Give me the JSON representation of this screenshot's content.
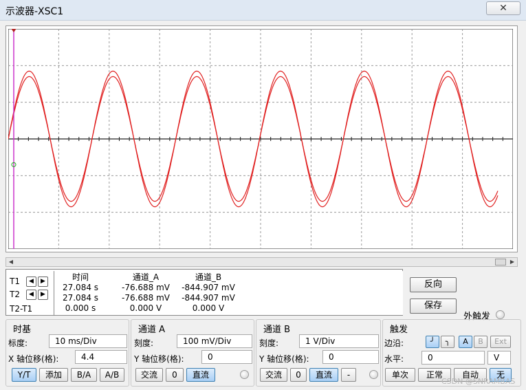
{
  "window": {
    "title": "示波器-XSC1",
    "close_icon": "close-icon"
  },
  "chart_data": {
    "type": "line",
    "title": "",
    "xlabel": "",
    "ylabel": "",
    "grid": true,
    "grid_divisions": {
      "x": 10,
      "y": 6
    },
    "x_per_div_ms": 10,
    "x_range_ms": [
      0,
      100
    ],
    "y_range_div": [
      -3,
      3
    ],
    "signal_period_ms": 16.6,
    "series": [
      {
        "color": "#e02020",
        "amplitude_div": 1.85,
        "phase": 0.0
      },
      {
        "color": "#e02020",
        "amplitude_div": 1.7,
        "phase": 0.0
      }
    ],
    "trigger_marker_color": "#18a818",
    "cursor_color": "#cc33cc"
  },
  "cursors": {
    "headers": [
      "时间",
      "通道_A",
      "通道_B"
    ],
    "rows": [
      {
        "label": "T1",
        "values": [
          "27.084 s",
          "-76.688 mV",
          "-844.907 mV"
        ]
      },
      {
        "label": "T2",
        "values": [
          "27.084 s",
          "-76.688 mV",
          "-844.907 mV"
        ]
      },
      {
        "label": "T2-T1",
        "values": [
          "0.000 s",
          "0.000 V",
          "0.000 V"
        ]
      }
    ]
  },
  "side_buttons": {
    "reverse": "反向",
    "save": "保存",
    "ext_trigger": "外触发"
  },
  "timebase": {
    "title": "时基",
    "scale_label": "标度:",
    "scale_value": "10 ms/Div",
    "xpos_label": "X 轴位移(格):",
    "xpos_value": "4.4",
    "modes": [
      "Y/T",
      "添加",
      "B/A",
      "A/B"
    ],
    "active_mode": "Y/T"
  },
  "channel_a": {
    "title": "通道 A",
    "scale_label": "刻度:",
    "scale_value": "100 mV/Div",
    "ypos_label": "Y 轴位移(格):",
    "ypos_value": "0",
    "coupling": [
      "交流",
      "0",
      "直流"
    ],
    "active": "直流"
  },
  "channel_b": {
    "title": "通道 B",
    "scale_label": "刻度:",
    "scale_value": "1  V/Div",
    "ypos_label": "Y 轴位移(格):",
    "ypos_value": "0",
    "coupling": [
      "交流",
      "0",
      "直流",
      "-"
    ],
    "active": "直流"
  },
  "trigger": {
    "title": "触发",
    "edge_label": "边沿:",
    "edge_buttons": [
      "A",
      "B",
      "Ext"
    ],
    "level_label": "水平:",
    "level_value": "0",
    "level_unit": "V",
    "modes": [
      "单次",
      "正常",
      "自动",
      "无"
    ],
    "active_mode": "无"
  },
  "watermark": "CSDN @SNRAMBAS"
}
